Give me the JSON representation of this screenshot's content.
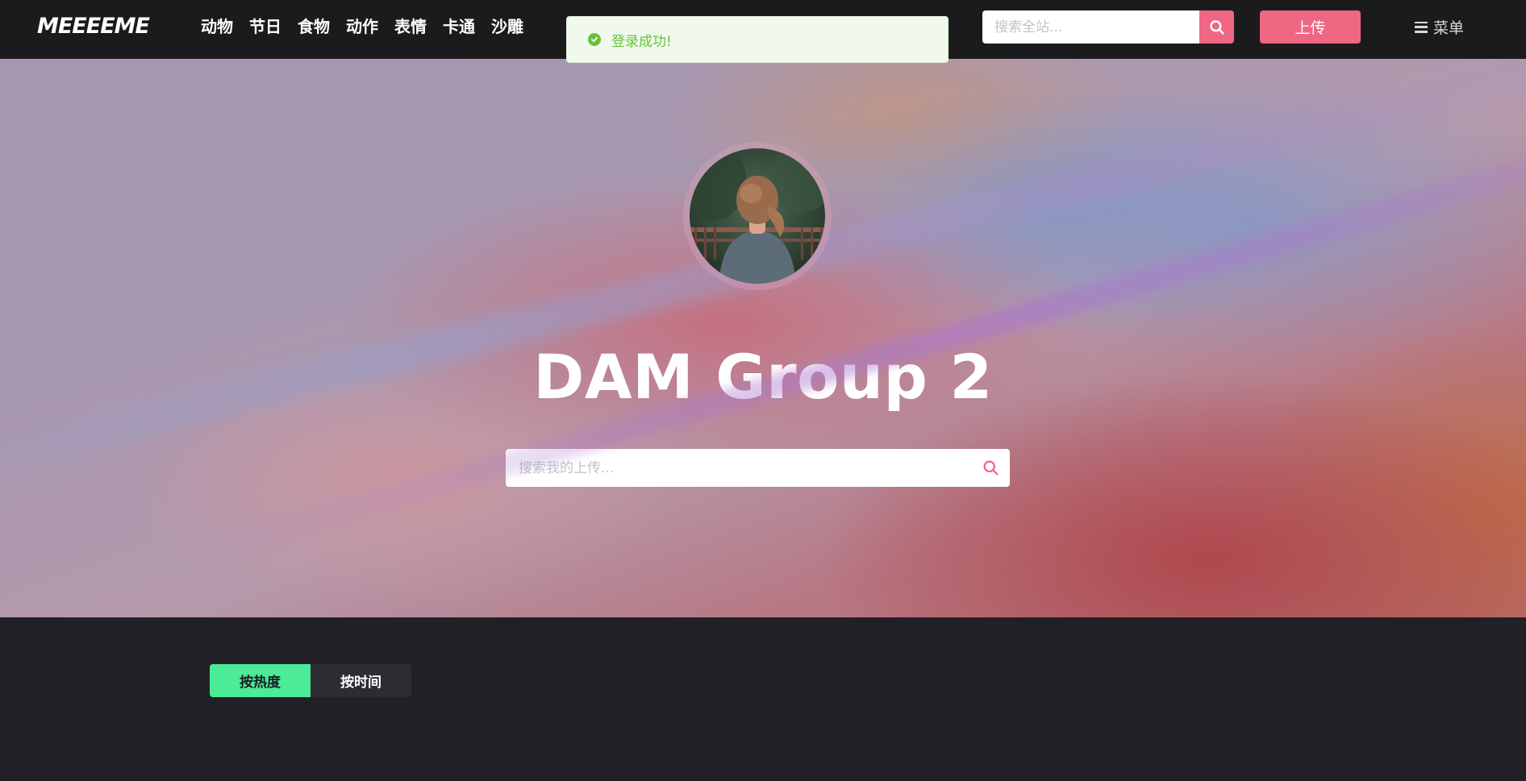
{
  "nav": {
    "logo": "MEEEEME",
    "links": [
      "动物",
      "节日",
      "食物",
      "动作",
      "表情",
      "卡通",
      "沙雕"
    ],
    "search_placeholder": "搜索全站...",
    "upload_label": "上传",
    "menu_label": "菜单"
  },
  "toast": {
    "message": "登录成功!",
    "type": "success"
  },
  "profile": {
    "name": "DAM Group 2",
    "search_placeholder": "搜索我的上传..."
  },
  "sort": {
    "tabs": [
      {
        "label": "按热度",
        "active": true
      },
      {
        "label": "按时间",
        "active": false
      }
    ]
  },
  "colors": {
    "accent_pink": "#ef6783",
    "accent_green": "#4beb97",
    "success_green": "#67c23a",
    "navbar_bg": "#1b1b1e",
    "page_bg": "#212026"
  },
  "icons": {
    "site_search": "search-icon",
    "my_search": "search-icon",
    "menu": "hamburger-icon",
    "toast": "check-circle-icon"
  }
}
